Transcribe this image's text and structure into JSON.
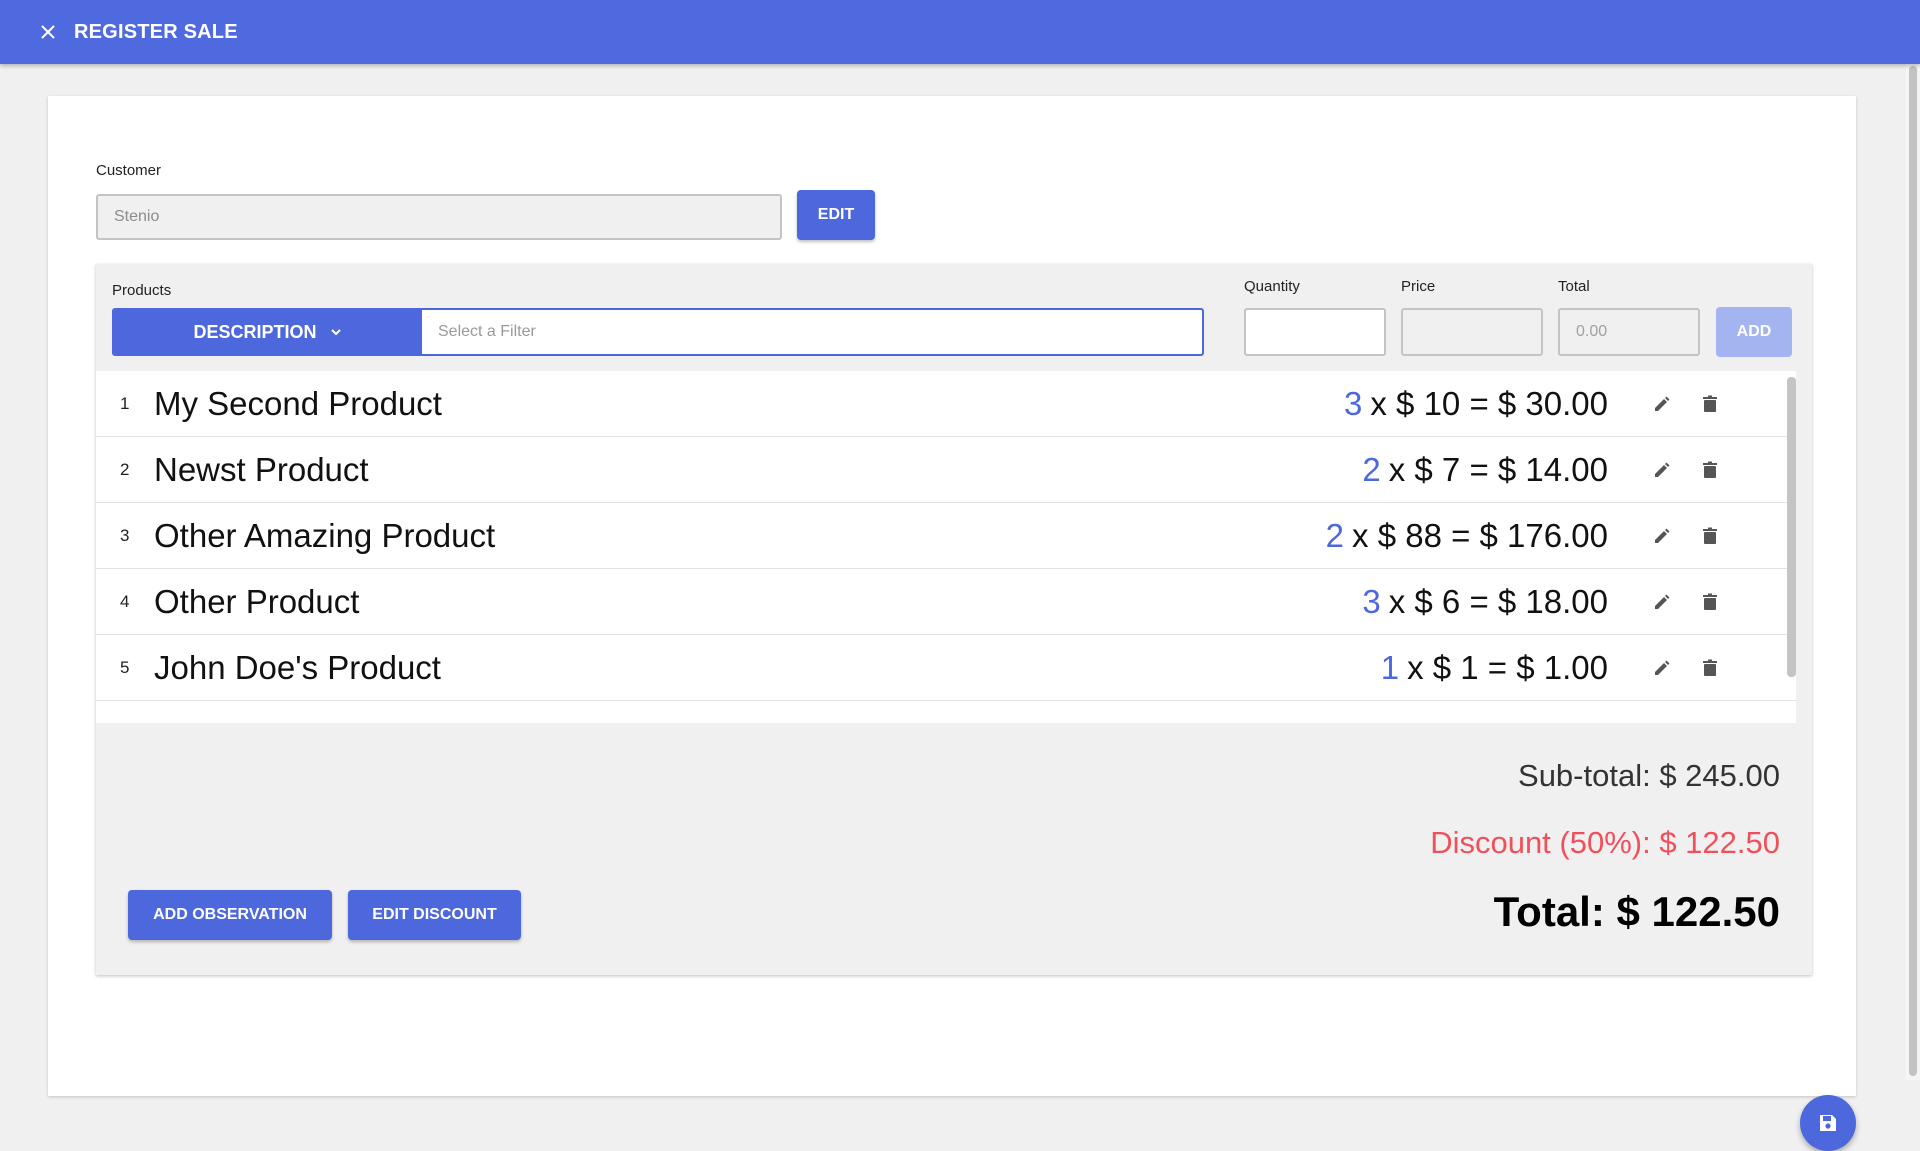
{
  "header": {
    "title": "REGISTER SALE"
  },
  "customer": {
    "label": "Customer",
    "value": "Stenio",
    "edit_label": "EDIT"
  },
  "products": {
    "label": "Products",
    "filter_select": "DESCRIPTION",
    "filter_placeholder": "Select a Filter",
    "quantity_label": "Quantity",
    "price_label": "Price",
    "total_label": "Total",
    "total_placeholder": "0.00",
    "add_label": "ADD"
  },
  "items": [
    {
      "num": "1",
      "name": "My Second Product",
      "qty": "3",
      "calc": "x $ 10 = $ 30.00"
    },
    {
      "num": "2",
      "name": "Newst Product",
      "qty": "2",
      "calc": "x $ 7 = $ 14.00"
    },
    {
      "num": "3",
      "name": "Other Amazing Product",
      "qty": "2",
      "calc": "x $ 88 = $ 176.00"
    },
    {
      "num": "4",
      "name": "Other Product",
      "qty": "3",
      "calc": "x $ 6 = $ 18.00"
    },
    {
      "num": "5",
      "name": "John Doe's Product",
      "qty": "1",
      "calc": "x $ 1 = $ 1.00"
    }
  ],
  "summary": {
    "subtotal": "Sub-total: $ 245.00",
    "discount": "Discount (50%): $ 122.50",
    "total": "Total: $ 122.50"
  },
  "actions": {
    "add_observation": "ADD OBSERVATION",
    "edit_discount": "EDIT DISCOUNT"
  },
  "icons": {
    "close": "close-icon",
    "dropdown": "chevron-down-icon",
    "edit": "pencil-icon",
    "delete": "trash-icon",
    "save": "floppy-disk-icon"
  },
  "colors": {
    "primary": "#4d68dc",
    "appbar": "#4f6ade",
    "discount": "#f0505c",
    "disabled_add": "#a3b4f0"
  }
}
